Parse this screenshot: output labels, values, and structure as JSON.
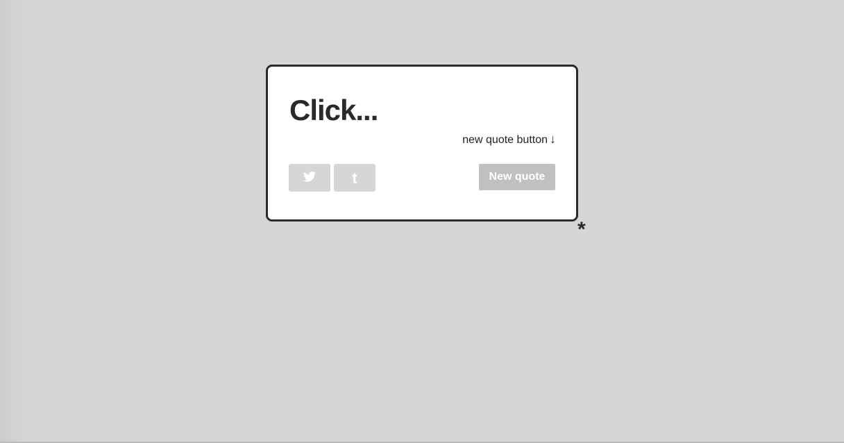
{
  "quote": {
    "text": "Click...",
    "author": "new quote button",
    "author_arrow": "↓"
  },
  "share": {
    "twitter_icon": "twitter-icon",
    "tumblr_icon": "tumblr-icon",
    "tumblr_glyph": "t"
  },
  "actions": {
    "new_quote_label": "New quote"
  },
  "footer": {
    "asterisk": "*"
  },
  "colors": {
    "background": "#d6d6d6",
    "box_border": "#2a2a2a",
    "share_button": "#d6d6d6",
    "new_quote_button": "#c0c0c0"
  }
}
